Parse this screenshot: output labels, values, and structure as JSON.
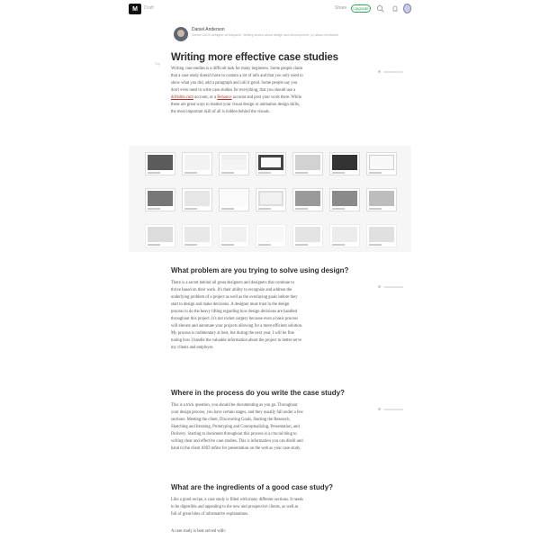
{
  "topbar": {
    "logo_text": "M",
    "home_label": "Draft",
    "nav_link": "Share",
    "upgrade_label": "Upgrade",
    "icons": [
      "search-icon",
      "bell-icon",
      "avatar"
    ]
  },
  "author": {
    "name": "Daniel Anderson",
    "bio": "Senior UI/UX designer at Mixpanel. Writing stories about design and development. (c) about.me/daniel",
    "avatar_icon": "avatar"
  },
  "article": {
    "side_note": "Top",
    "title": "Writing more effective case studies",
    "intro": [
      "Writing case studies is a difficult task for many beginners. Some people claim",
      "that a case study doesn't have to contain a lot of info and that you only need to",
      "show what you did, add a paragraph and call it good. Some people say you",
      "don't even need to write case studies for everything, that you should use a",
      "account, or a",
      "account and post your work there. While",
      "these are great ways to market your visual design or animation design skills,",
      "the most important skill of all is hidden behind the visuals."
    ],
    "link_dribbble": "dribbble.com",
    "link_behance": "Behance",
    "sections": [
      {
        "heading": "What problem are you trying to solve using design?",
        "lines": [
          "There is a secret behind all great designers and designers that continue to",
          "thrive based on their work. It's their ability to recognize and address the",
          "underlying problem of a project as well as the overlaying goals before they",
          "start to design and make decisions. A designer must trust in the design",
          "process to do the heavy lifting regarding how design decisions are handled",
          "throughout this project. It's not rocket surgery because even a basic process",
          "will elevate and automate your projects allowing for a more efficient solution.",
          "My process is rudimentary at best, but during the next year, I will be fine",
          "tuning how I handle the valuable information about the project to better serve",
          "my clients and employer."
        ]
      },
      {
        "heading": "Where in the process do you write the case study?",
        "lines": [
          "This is a trick question, you should be documenting as you go. Throughout",
          "your design process, you have certain stages, and they usually fall under a few",
          "sections: Meeting the client, Discovering Goals, Starting the Research,",
          "Sketching and Iterating, Prototyping and Conceptualizing, Presentation, and",
          "Delivery. Starting to document throughout this process is a crucial thing to",
          "writing clear and effective case studies. This is information you can distill and",
          "hand to the client AND refine for presentation on the web as your case study."
        ]
      },
      {
        "heading": "What are the ingredients of a good case study?",
        "lines": [
          "Like a good recipe, a case study is filled with many different sections. It needs",
          "to be digestible and appealing to the new and prospective clients, as well as",
          "full of great bites of informative explanations."
        ],
        "trailing": "A case study is best served with:"
      }
    ]
  },
  "gallery": {
    "rows": 3,
    "cols": 7
  },
  "colors": {
    "accent_green": "#38a55c",
    "link_red": "#b4322a",
    "text": "#555555",
    "heading": "#2d2d2d"
  }
}
